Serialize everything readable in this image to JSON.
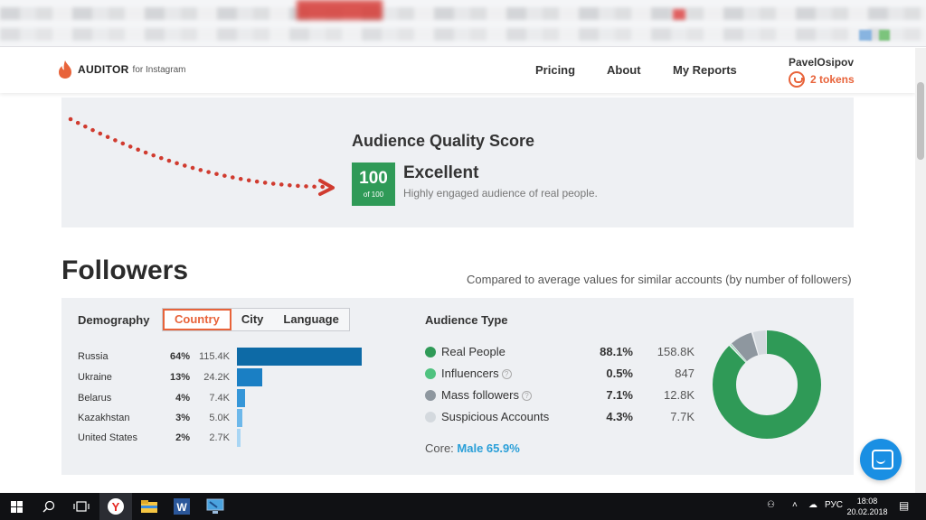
{
  "nav": {
    "brand": "AUDITOR",
    "brand_sub": "for Instagram",
    "links": [
      "Pricing",
      "About",
      "My Reports"
    ],
    "user_name": "PavelOsipov",
    "tokens": "2 tokens"
  },
  "quality": {
    "title": "Audience Quality Score",
    "score": "100",
    "score_of": "of 100",
    "verdict": "Excellent",
    "description": "Highly engaged audience of real people.",
    "score_color": "#2f9a57"
  },
  "followers": {
    "title": "Followers",
    "compare_note": "Compared to average values for similar accounts (by number of followers)"
  },
  "demography": {
    "label": "Demography",
    "tabs": [
      "Country",
      "City",
      "Language"
    ],
    "active_tab": "Country",
    "countries": [
      {
        "name": "Russia",
        "pct": "64%",
        "count": "115.4K",
        "share": 64,
        "color": "#0d6aa6"
      },
      {
        "name": "Ukraine",
        "pct": "13%",
        "count": "24.2K",
        "share": 13,
        "color": "#1a7fc4"
      },
      {
        "name": "Belarus",
        "pct": "4%",
        "count": "7.4K",
        "share": 4,
        "color": "#3596d8"
      },
      {
        "name": "Kazakhstan",
        "pct": "3%",
        "count": "5.0K",
        "share": 3,
        "color": "#6db8ea"
      },
      {
        "name": "United States",
        "pct": "2%",
        "count": "2.7K",
        "share": 2,
        "color": "#a9d6f4"
      }
    ]
  },
  "audience": {
    "label": "Audience Type",
    "rows": [
      {
        "name": "Real People",
        "pct": "88.1%",
        "count": "158.8K",
        "share": 88.1,
        "color": "#2f9a57",
        "help": false
      },
      {
        "name": "Influencers",
        "pct": "0.5%",
        "count": "847",
        "share": 0.5,
        "color": "#4fc27f",
        "help": true
      },
      {
        "name": "Mass followers",
        "pct": "7.1%",
        "count": "12.8K",
        "share": 7.1,
        "color": "#8e979f",
        "help": true
      },
      {
        "name": "Suspicious Accounts",
        "pct": "4.3%",
        "count": "7.7K",
        "share": 4.3,
        "color": "#d4d9de",
        "help": false
      }
    ],
    "core_label": "Core:",
    "core_value": "Male 65.9%"
  },
  "taskbar": {
    "lang": "РУС",
    "time": "18:08",
    "date": "20.02.2018"
  }
}
